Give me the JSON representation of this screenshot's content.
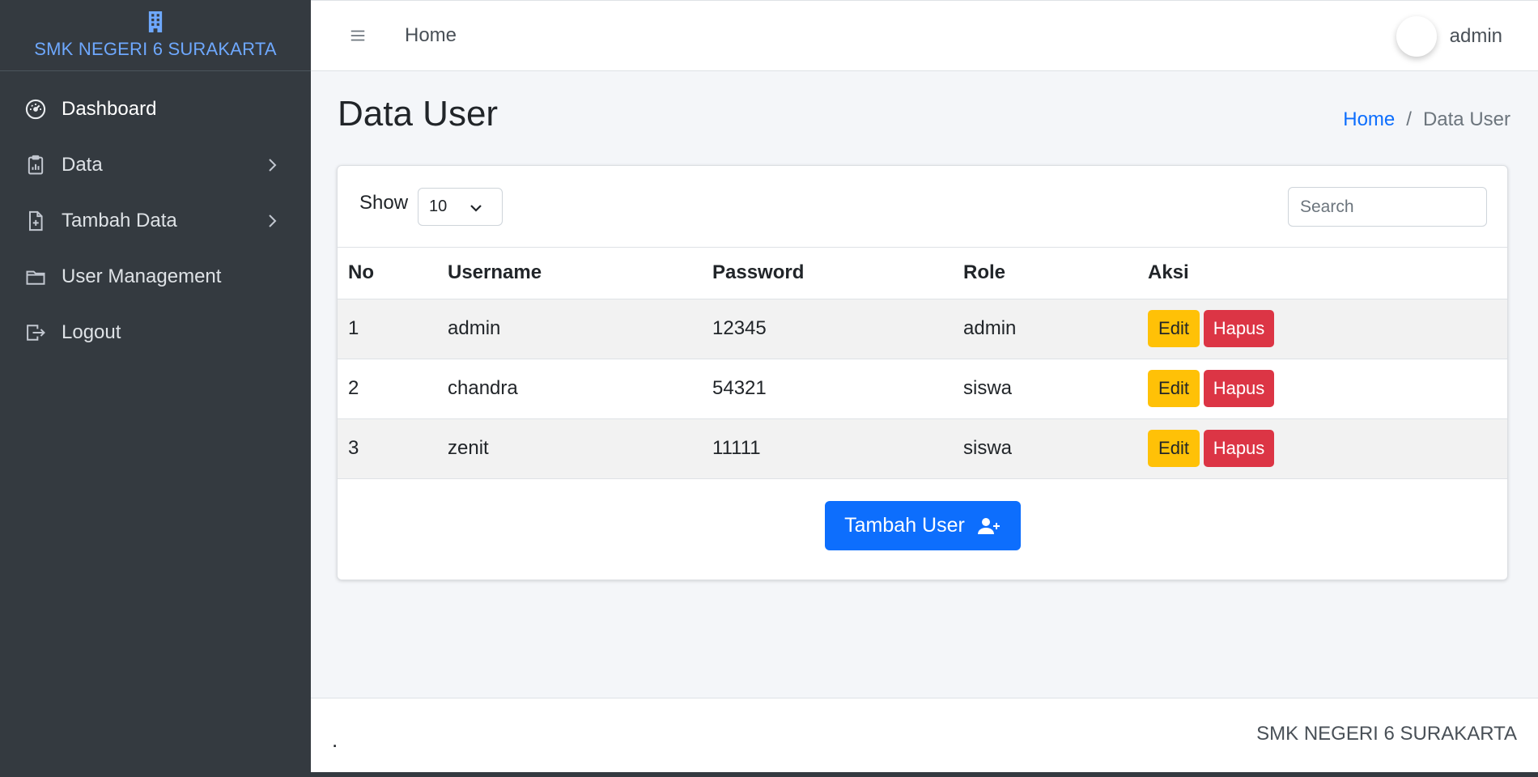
{
  "brand": {
    "icon": "building-icon",
    "name": "SMK NEGERI 6 SURAKARTA"
  },
  "sidebar": {
    "items": [
      {
        "label": "Dashboard",
        "icon": "speedometer-icon",
        "active": true
      },
      {
        "label": "Data",
        "icon": "clipboard-data-icon",
        "has_submenu": true
      },
      {
        "label": "Tambah Data",
        "icon": "file-plus-icon",
        "has_submenu": true
      },
      {
        "label": "User Management",
        "icon": "folder-icon"
      },
      {
        "label": "Logout",
        "icon": "box-arrow-right-icon"
      }
    ]
  },
  "topbar": {
    "menu_icon": "hamburger-icon",
    "home_label": "Home",
    "user_name": "admin"
  },
  "page": {
    "title": "Data User",
    "breadcrumb": {
      "home": "Home",
      "separator": "/",
      "current": "Data User"
    }
  },
  "table_controls": {
    "show_label": "Show",
    "show_value": "10",
    "search_placeholder": "Search"
  },
  "table": {
    "headers": [
      "No",
      "Username",
      "Password",
      "Role",
      "Aksi"
    ],
    "rows": [
      {
        "no": "1",
        "username": "admin",
        "password": "12345",
        "role": "admin"
      },
      {
        "no": "2",
        "username": "chandra",
        "password": "54321",
        "role": "siswa"
      },
      {
        "no": "3",
        "username": "zenit",
        "password": "11111",
        "role": "siswa"
      }
    ],
    "edit_label": "Edit",
    "delete_label": "Hapus"
  },
  "add_button": {
    "label": "Tambah User",
    "icon": "person-plus-icon"
  },
  "footer": {
    "left": ".",
    "right": "SMK NEGERI 6 SURAKARTA"
  },
  "colors": {
    "sidebar_bg": "#343a40",
    "brand_text": "#6ea8fe",
    "primary": "#0d6efd",
    "warning": "#ffc107",
    "danger": "#dc3545",
    "content_bg": "#f4f6f9"
  }
}
